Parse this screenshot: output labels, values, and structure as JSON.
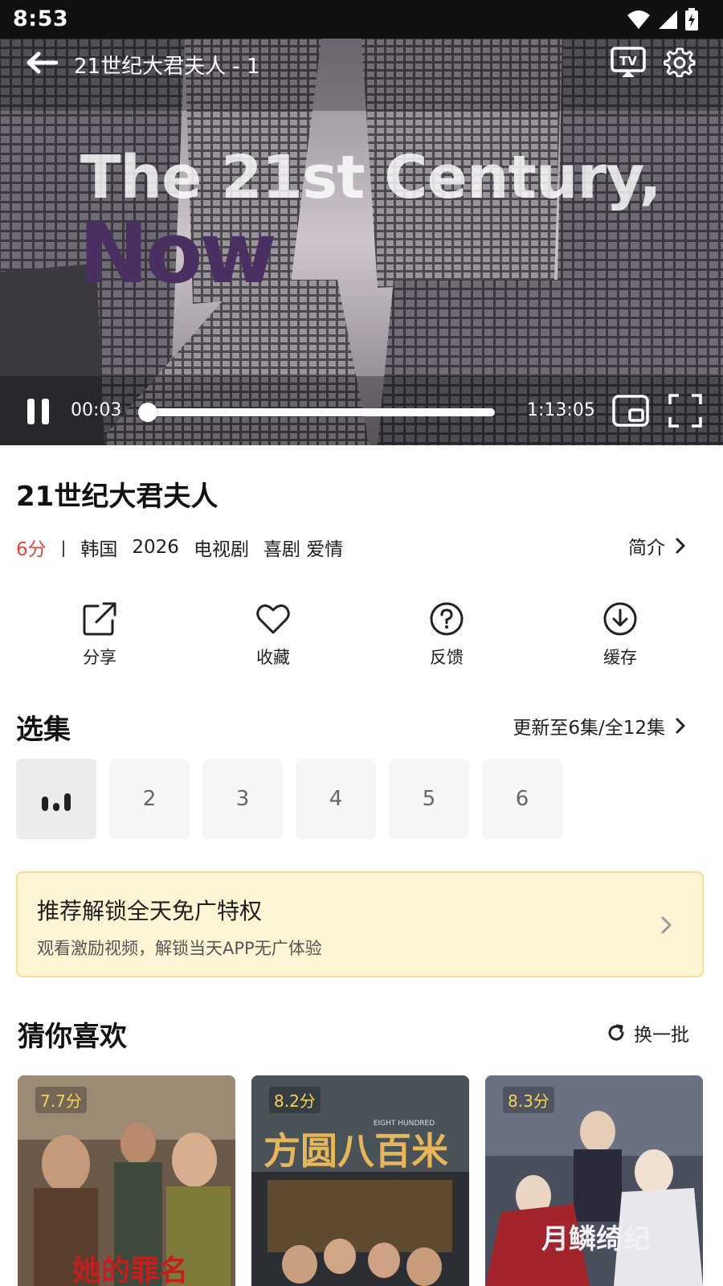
{
  "status_bar": {
    "time": "8:53"
  },
  "player": {
    "title": "21世纪大君夫人 - 1",
    "overlay_line1": "The 21st Century,",
    "overlay_line2": "Now",
    "current_time": "00:03",
    "total_time": "1:13:05",
    "progress": 0.0007,
    "tv_label": "TV"
  },
  "info": {
    "title": "21世纪大君夫人",
    "score": "6分",
    "separator": "|",
    "country": "韩国",
    "year": "2026",
    "category": "电视剧",
    "genres": "喜剧 爱情",
    "intro_label": "简介"
  },
  "actions": [
    {
      "label": "分享",
      "icon": "share-icon"
    },
    {
      "label": "收藏",
      "icon": "heart-icon"
    },
    {
      "label": "反馈",
      "icon": "question-icon"
    },
    {
      "label": "缓存",
      "icon": "download-icon"
    }
  ],
  "episodes": {
    "title": "选集",
    "update_text": "更新至6集/全12集",
    "items": [
      "1",
      "2",
      "3",
      "4",
      "5",
      "6"
    ],
    "current_index": 0
  },
  "ad_banner": {
    "title": "推荐解锁全天免广特权",
    "subtitle": "观看激励视频，解锁当天APP无广体验"
  },
  "recommend": {
    "title": "猜你喜欢",
    "refresh_label": "换一批",
    "items": [
      {
        "score": "7.7分",
        "poster_text": "她的罪名"
      },
      {
        "score": "8.2分",
        "poster_text": "方圆八百米",
        "poster_sub": "EIGHT HUNDRED"
      },
      {
        "score": "8.3分",
        "poster_text": "月鳞绮纪"
      }
    ]
  },
  "colors": {
    "accent_red": "#e0463a",
    "banner_bg": "#fdf4d4",
    "banner_border": "#f3dd95",
    "score_yellow": "#f4d35e"
  }
}
